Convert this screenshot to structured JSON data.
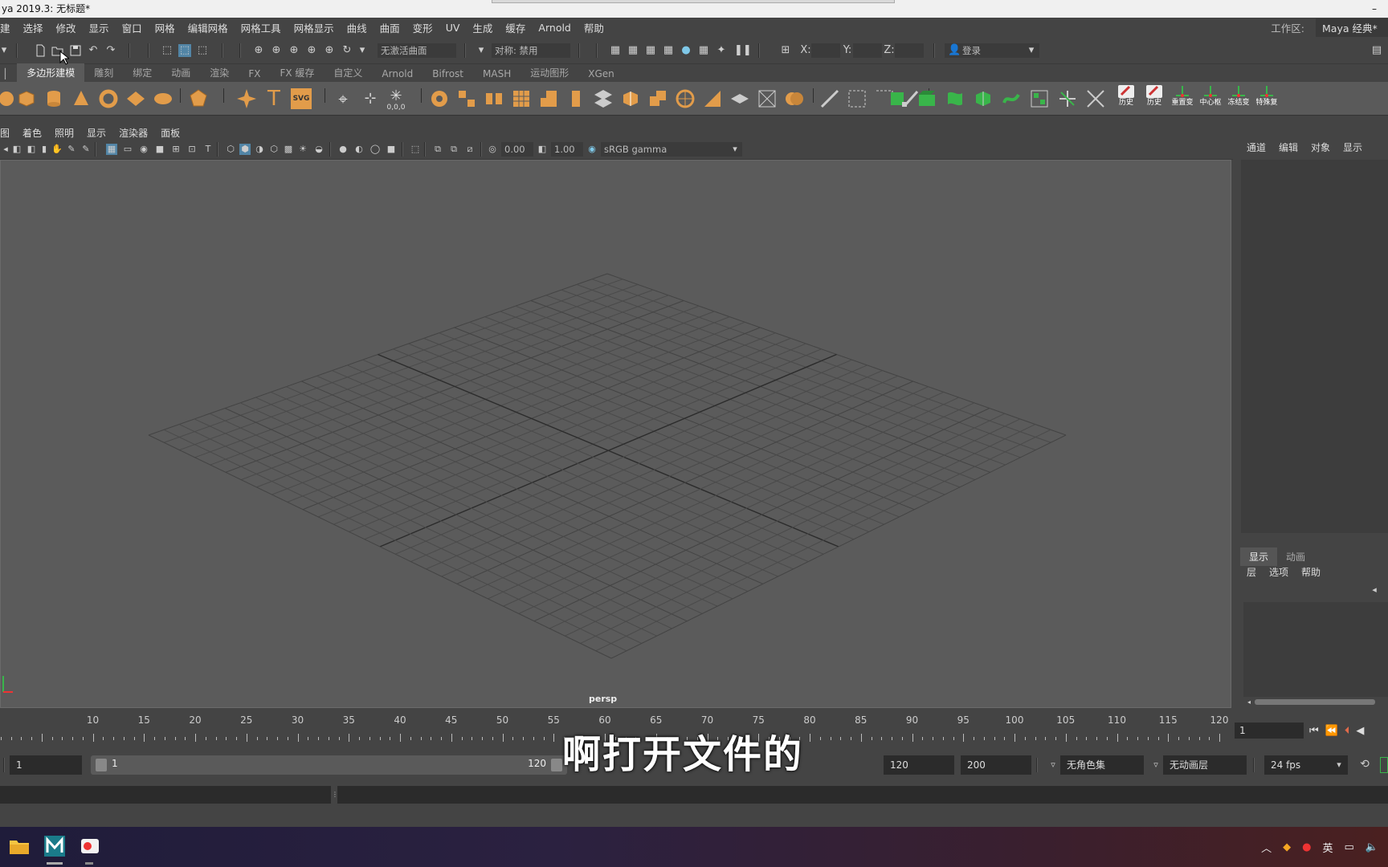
{
  "window": {
    "title": "ya 2019.3: 无标题*",
    "minimize": "–"
  },
  "menubar": {
    "items": [
      "建",
      "选择",
      "修改",
      "显示",
      "窗口",
      "网格",
      "编辑网格",
      "网格工具",
      "网格显示",
      "曲线",
      "曲面",
      "变形",
      "UV",
      "生成",
      "缓存",
      "Arnold",
      "帮助"
    ],
    "workspace_label": "工作区:",
    "workspace_value": "Maya 经典*"
  },
  "statusline": {
    "live_surface": "无激活曲面",
    "symmetry": "对称: 禁用",
    "x_label": "X:",
    "y_label": "Y:",
    "z_label": "Z:",
    "login": "登录"
  },
  "shelf": {
    "tabs": [
      "多边形建模",
      "雕刻",
      "绑定",
      "动画",
      "渲染",
      "FX",
      "FX 缓存",
      "自定义",
      "Arnold",
      "Bifrost",
      "MASH",
      "运动图形",
      "XGen"
    ],
    "active_tab": "多边形建模",
    "labels": [
      "历史",
      "历史",
      "重置变",
      "中心枢",
      "冻结变",
      "特殊复"
    ],
    "text_tool": "T",
    "svg_tool": "SVG",
    "origin_label": "0,0,0"
  },
  "panel": {
    "menus": [
      "图",
      "着色",
      "照明",
      "显示",
      "渲染器",
      "面板"
    ],
    "exposure": "0.00",
    "gamma": "1.00",
    "colorspace": "sRGB gamma",
    "camera": "persp"
  },
  "channelbox": {
    "menus": [
      "通道",
      "编辑",
      "对象",
      "显示"
    ]
  },
  "layers": {
    "tabs": [
      "显示",
      "动画"
    ],
    "active_tab": "显示",
    "menus": [
      "层",
      "选项",
      "帮助"
    ]
  },
  "timeline": {
    "ticks": [
      10,
      15,
      20,
      25,
      30,
      35,
      40,
      45,
      50,
      55,
      60,
      65,
      70,
      75,
      80,
      85,
      90,
      95,
      100,
      105,
      110,
      115,
      120
    ],
    "current_frame": "1"
  },
  "range": {
    "start": "1",
    "slider_start": "1",
    "slider_end": "120",
    "end": "120",
    "anim_end": "200",
    "character_set": "无角色集",
    "anim_layer": "无动画层",
    "fps": "24 fps"
  },
  "subtitle": "啊打开文件的",
  "tray": {
    "ime": "英"
  },
  "colors": {
    "accent": "#5285a6",
    "shelf_orange": "#e29c4a",
    "shelf_green": "#39b54a"
  }
}
